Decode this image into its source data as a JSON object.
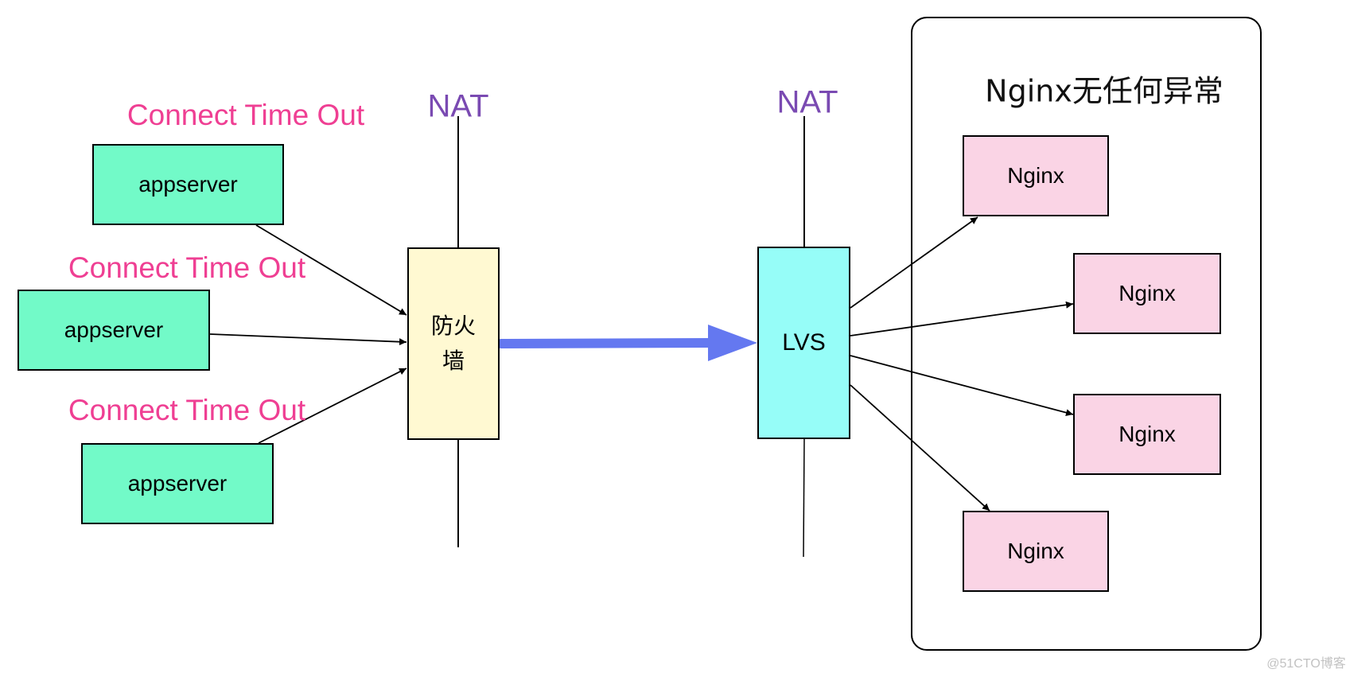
{
  "diagram": {
    "client_nodes": [
      {
        "label": "appserver",
        "status": "Connect Time Out"
      },
      {
        "label": "appserver",
        "status": "Connect Time Out"
      },
      {
        "label": "appserver",
        "status": "Connect Time Out"
      }
    ],
    "firewall": {
      "label_line1": "防火",
      "label_line2": "墙",
      "nat_label": "NAT"
    },
    "load_balancer": {
      "label": "LVS",
      "nat_label": "NAT"
    },
    "backend_group": {
      "title": "Nginx无任何异常",
      "nodes": [
        {
          "label": "Nginx"
        },
        {
          "label": "Nginx"
        },
        {
          "label": "Nginx"
        },
        {
          "label": "Nginx"
        }
      ]
    },
    "edges": [
      {
        "from": "appserver-1",
        "to": "firewall"
      },
      {
        "from": "appserver-2",
        "to": "firewall"
      },
      {
        "from": "appserver-3",
        "to": "firewall"
      },
      {
        "from": "firewall",
        "to": "lvs",
        "style": "thick-blue"
      },
      {
        "from": "lvs",
        "to": "nginx-1"
      },
      {
        "from": "lvs",
        "to": "nginx-2"
      },
      {
        "from": "lvs",
        "to": "nginx-3"
      },
      {
        "from": "lvs",
        "to": "nginx-4"
      }
    ],
    "colors": {
      "appserver": "#72fac8",
      "firewall": "#fff9d2",
      "lvs": "#96fdf8",
      "nginx": "#fad4e5",
      "timeout_text": "#ef3f93",
      "nat_text": "#7a4ab2",
      "main_flow_arrow": "#6478f0"
    }
  },
  "watermark": "@51CTO博客"
}
